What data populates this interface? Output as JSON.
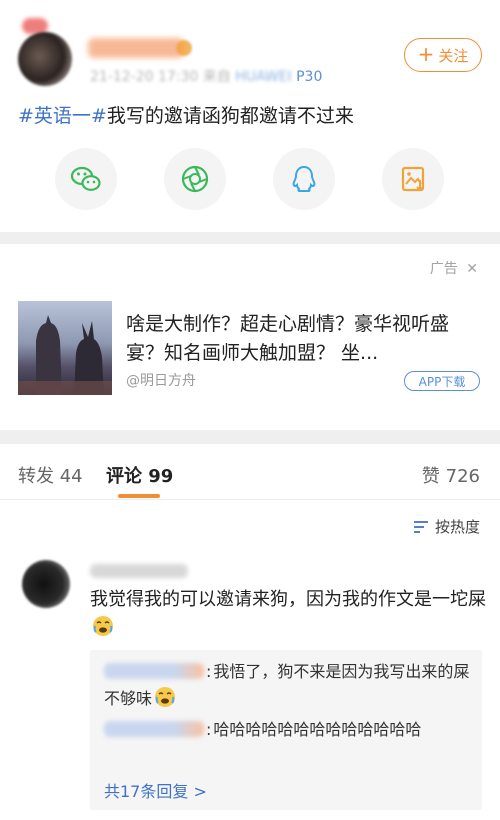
{
  "post": {
    "meta_date": "21-12-20 17:30",
    "meta_source": "来自",
    "meta_device_visible": "P30",
    "follow_label": "关注",
    "hashtag": "#英语一#",
    "text": "我写的邀请函狗都邀请不过来",
    "share_icons": [
      "wechat-icon",
      "moments-icon",
      "qq-icon",
      "save-image-icon"
    ],
    "colors": {
      "accent": "#f28d33",
      "link": "#3f72c8",
      "wechat": "#3bb95a",
      "qq": "#3aa8e8",
      "save": "#f2a23a"
    }
  },
  "ad": {
    "label": "广告",
    "title": "啥是大制作？超走心剧情？豪华视听盛宴？知名画师大触加盟？ 坐...",
    "source": "@明日方舟",
    "download_label": "APP下载"
  },
  "tabs": {
    "repost": {
      "label": "转发",
      "count": "44"
    },
    "comments": {
      "label": "评论",
      "count": "99"
    },
    "likes": {
      "label": "赞",
      "count": "726"
    }
  },
  "sort": {
    "label": "按热度"
  },
  "comment": {
    "text": "我觉得我的可以邀请来狗，因为我的作文是一坨屎",
    "replies": [
      {
        "text": "我悟了，狗不来是因为我写出来的屎不够味"
      },
      {
        "text": "哈哈哈哈哈哈哈哈哈哈哈哈哈"
      }
    ],
    "more_replies": "共17条回复 >"
  }
}
